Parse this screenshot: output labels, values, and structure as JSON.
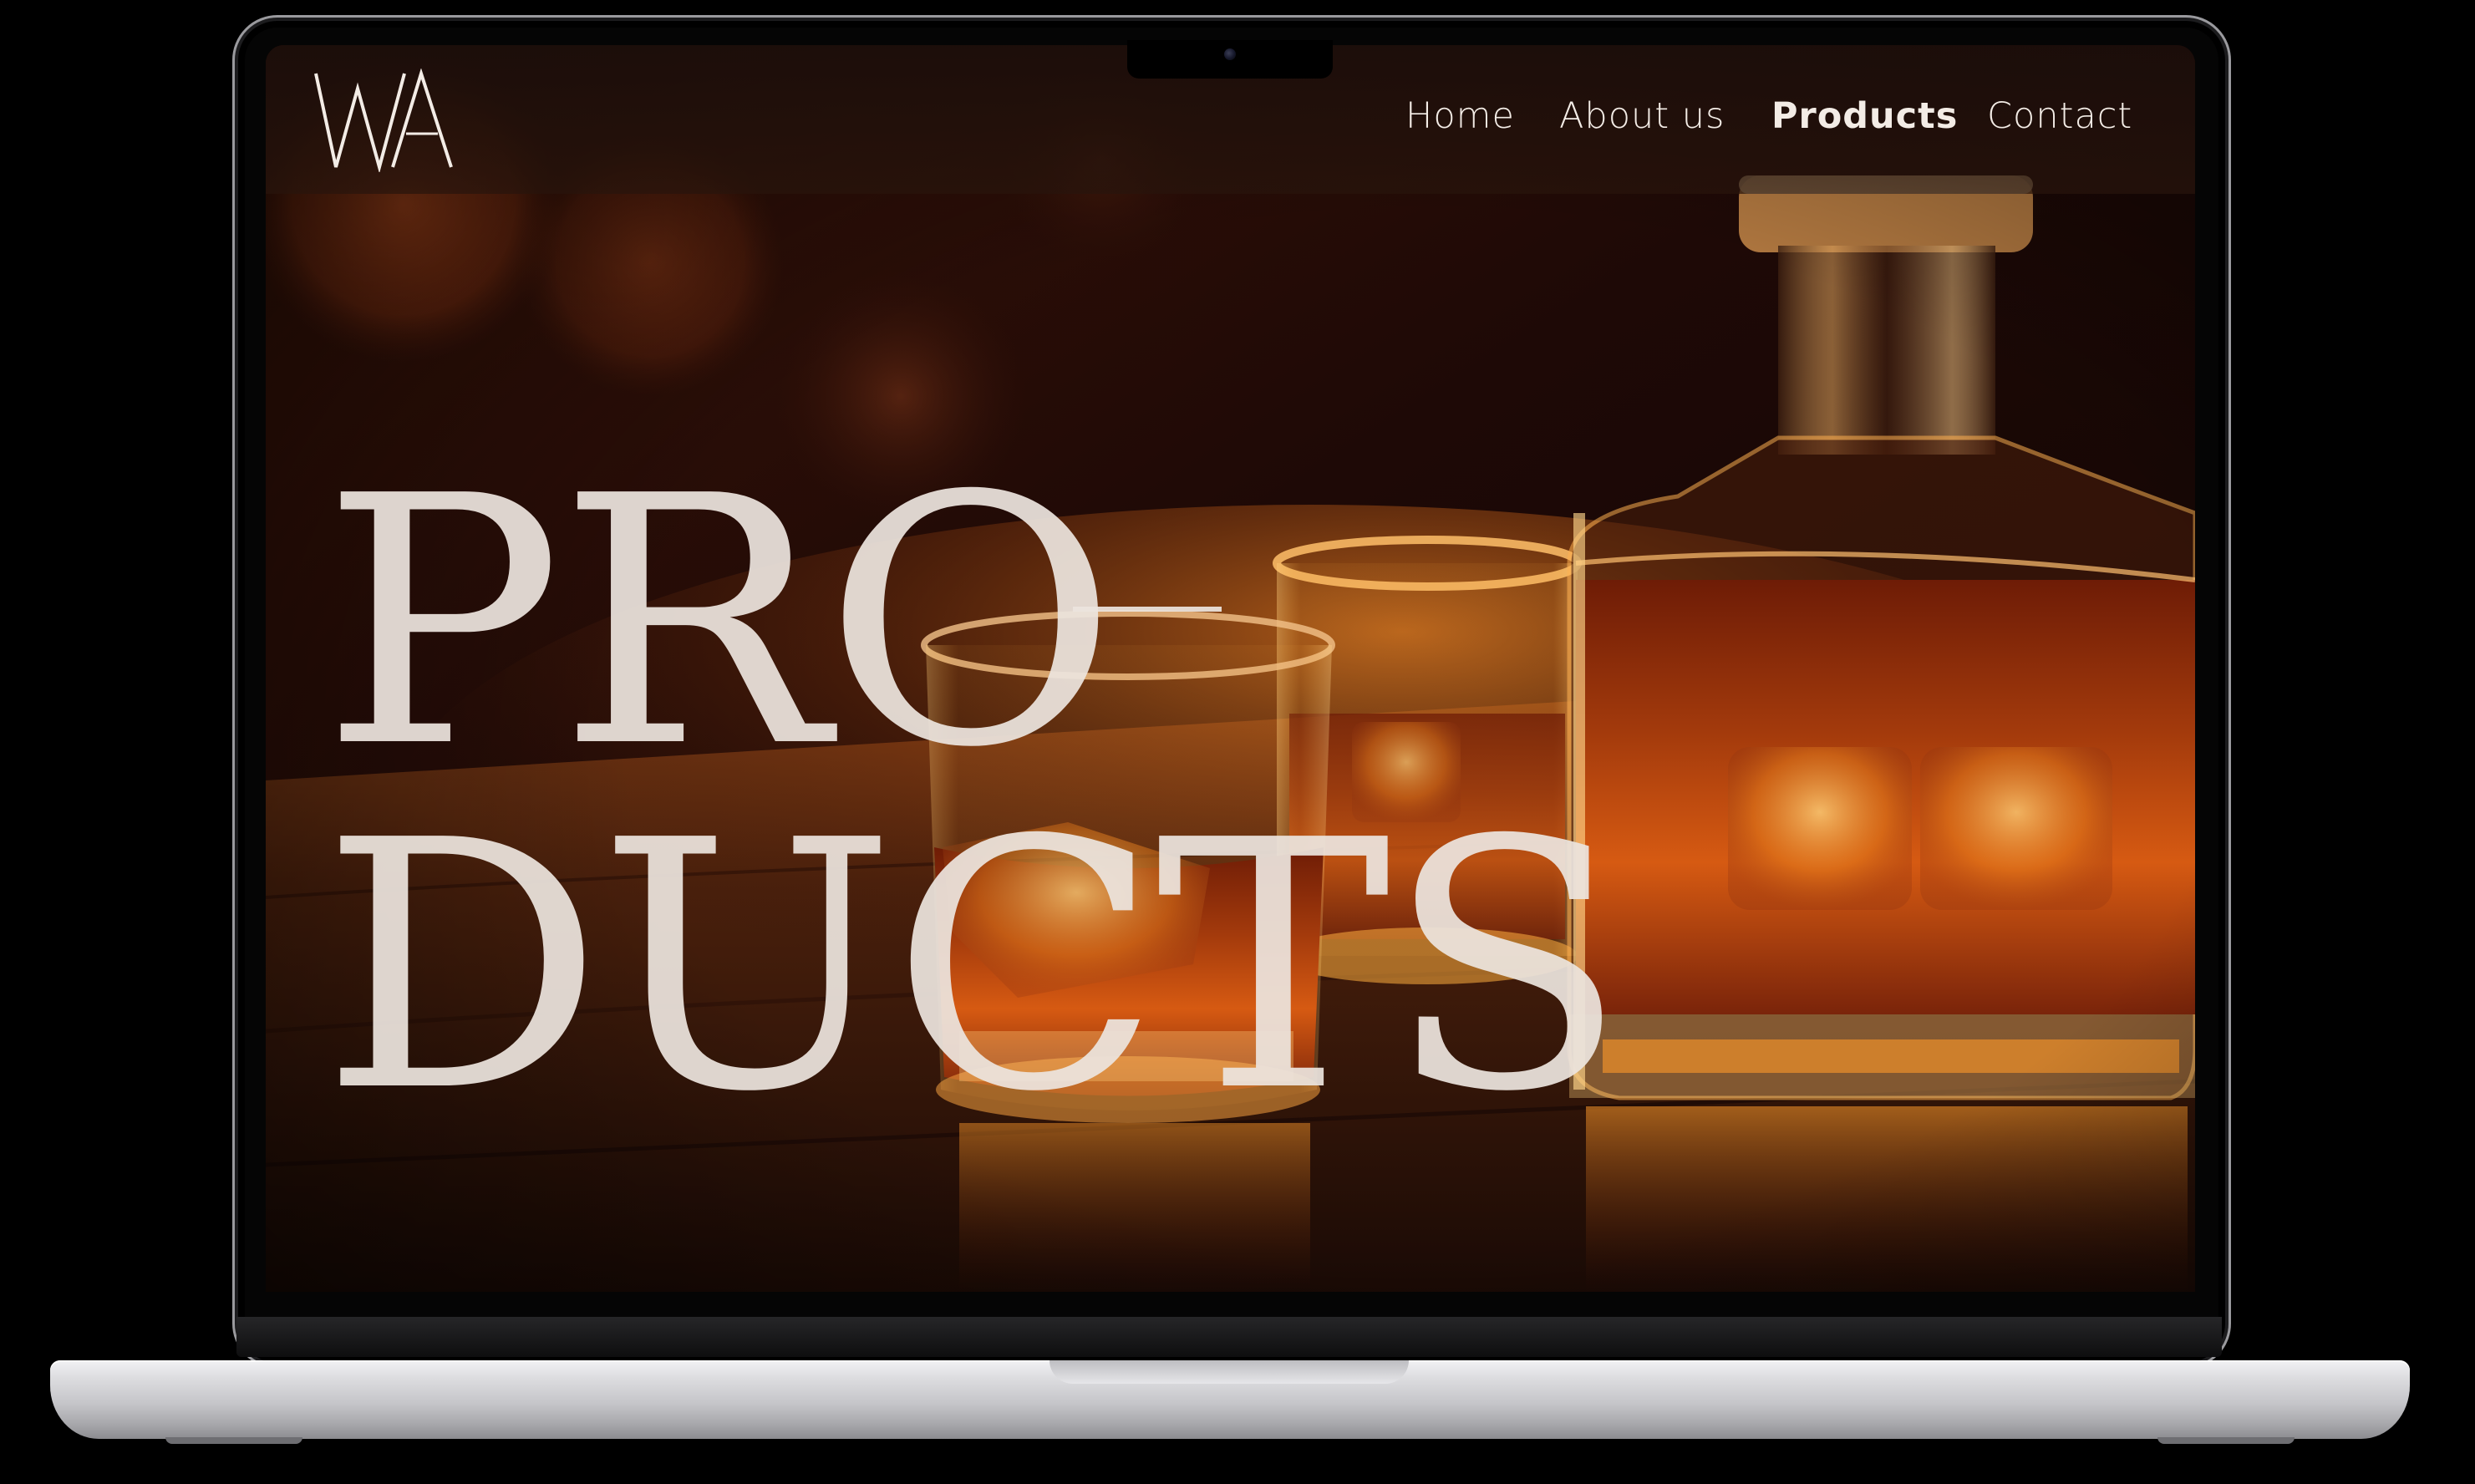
{
  "site": {
    "logo_text": "WA",
    "nav": [
      {
        "label": "Home",
        "active": false
      },
      {
        "label": "About us",
        "active": false
      },
      {
        "label": "Products",
        "active": true
      },
      {
        "label": "Contact",
        "active": false
      }
    ]
  },
  "hero": {
    "title_line1": "PRO",
    "title_line2": "DUCTS"
  },
  "colors": {
    "accent_amber": "#e07a1c",
    "nav_text": "#f3ece6",
    "headline_text": "#ece4de",
    "background_dark": "#1a0805"
  },
  "icons": [
    "wa-logo-icon",
    "camera-icon"
  ]
}
